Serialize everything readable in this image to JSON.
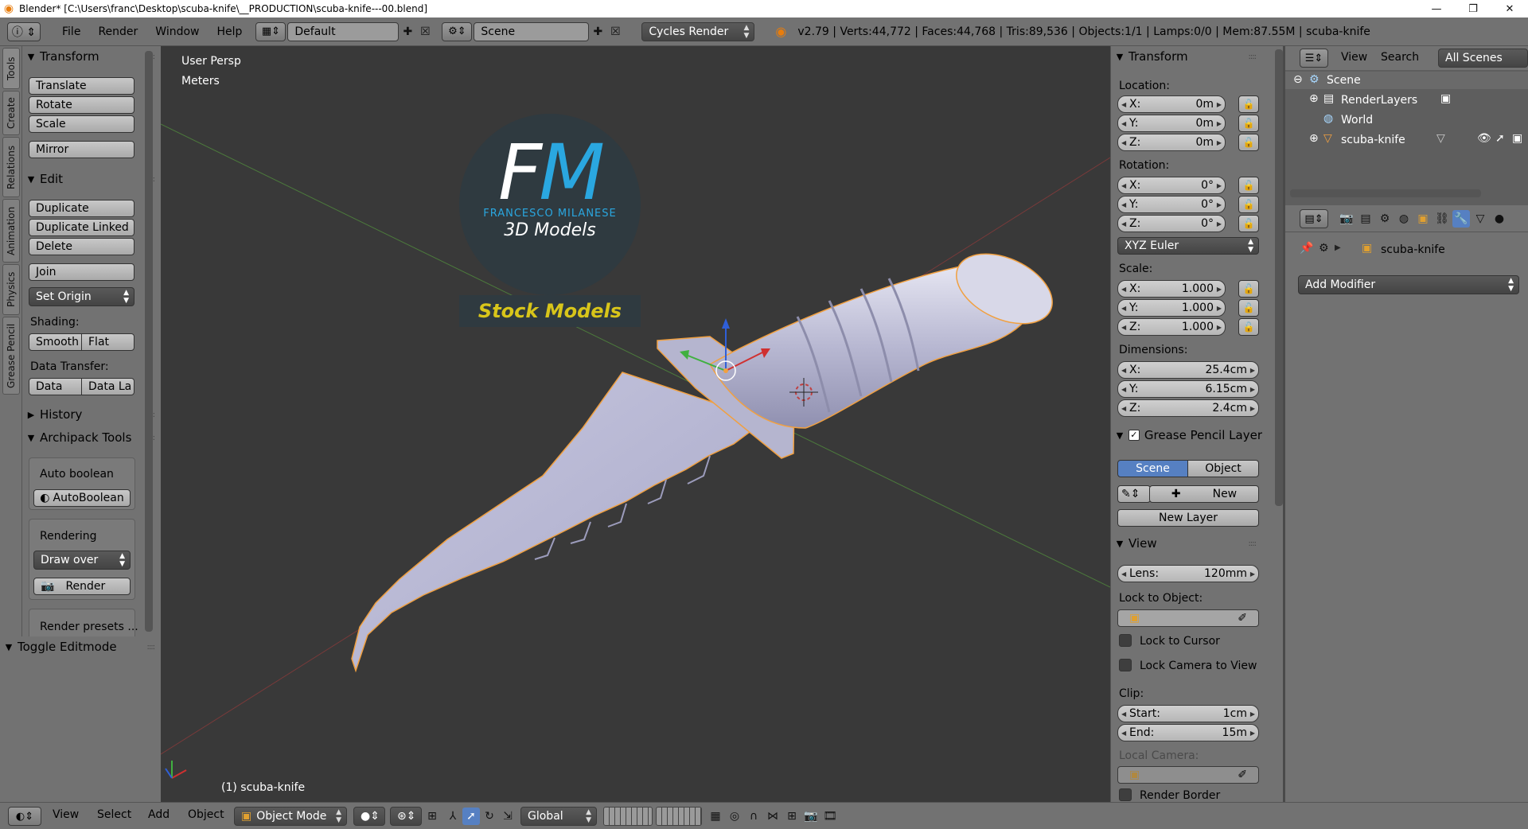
{
  "window": {
    "title": "Blender* [C:\\Users\\franc\\Desktop\\scuba-knife\\__PRODUCTION\\scuba-knife---00.blend]",
    "minimize": "—",
    "maximize": "❐",
    "close": "✕"
  },
  "info_header": {
    "menus": [
      "File",
      "Render",
      "Window",
      "Help"
    ],
    "screen_layout": "Default",
    "scene": "Scene",
    "render_engine": "Cycles Render",
    "stats": "v2.79 | Verts:44,772 | Faces:44,768 | Tris:89,536 | Objects:1/1 | Lamps:0/0 | Mem:87.55M | scuba-knife"
  },
  "left_tabs": [
    "Tools",
    "Create",
    "Relations",
    "Animation",
    "Physics",
    "Grease Pencil"
  ],
  "tool_shelf": {
    "transform": {
      "title": "Transform",
      "buttons": [
        "Translate",
        "Rotate",
        "Scale",
        "Mirror"
      ]
    },
    "edit": {
      "title": "Edit",
      "buttons": [
        "Duplicate",
        "Duplicate Linked",
        "Delete",
        "Join"
      ],
      "set_origin": "Set Origin",
      "shading_label": "Shading:",
      "smooth": "Smooth",
      "flat": "Flat",
      "data_transfer_label": "Data Transfer:",
      "data": "Data",
      "data_la": "Data La"
    },
    "history": {
      "title": "History"
    },
    "archipack": {
      "title": "Archipack Tools",
      "auto_boolean_label": "Auto boolean",
      "auto_boolean_btn": "AutoBoolean",
      "rendering_label": "Rendering",
      "draw_over": "Draw over",
      "render_btn": "Render",
      "render_presets": "Render presets ..."
    },
    "toggle_editmode": "Toggle Editmode"
  },
  "viewport": {
    "view_name": "User Persp",
    "units": "Meters",
    "object_label": "(1) scuba-knife",
    "logo_fm": "FM",
    "logo_name": "FRANCESCO MILANESE",
    "logo_3d": "3D Models",
    "logo_stock": "Stock Models"
  },
  "n_panel": {
    "transform_title": "Transform",
    "location_label": "Location:",
    "location": {
      "x": "0m",
      "y": "0m",
      "z": "0m"
    },
    "rotation_label": "Rotation:",
    "rotation": {
      "x": "0°",
      "y": "0°",
      "z": "0°"
    },
    "rotation_mode": "XYZ Euler",
    "scale_label": "Scale:",
    "scale": {
      "x": "1.000",
      "y": "1.000",
      "z": "1.000"
    },
    "dimensions_label": "Dimensions:",
    "dimensions": {
      "x": "25.4cm",
      "y": "6.15cm",
      "z": "2.4cm"
    },
    "axis_x": "X:",
    "axis_y": "Y:",
    "axis_z": "Z:",
    "grease_title": "Grease Pencil Layer",
    "scene_tab": "Scene",
    "object_tab": "Object",
    "new_btn": "New",
    "new_layer_btn": "New Layer",
    "view_title": "View",
    "lens_label": "Lens:",
    "lens_value": "120mm",
    "lock_to_object_label": "Lock to Object:",
    "lock_to_cursor": "Lock to Cursor",
    "lock_camera": "Lock Camera to View",
    "clip_label": "Clip:",
    "clip_start_label": "Start:",
    "clip_start": "1cm",
    "clip_end_label": "End:",
    "clip_end": "15m",
    "local_camera_label": "Local Camera:",
    "render_border": "Render Border"
  },
  "outliner": {
    "view": "View",
    "search": "Search",
    "filter": "All Scenes",
    "items": [
      "Scene",
      "RenderLayers",
      "World",
      "scuba-knife"
    ]
  },
  "properties": {
    "object_name": "scuba-knife",
    "add_modifier": "Add Modifier"
  },
  "bottom_header": {
    "menus": [
      "View",
      "Select",
      "Add",
      "Object"
    ],
    "mode": "Object Mode",
    "orientation": "Global"
  },
  "colors": {
    "panel_bg": "#727272",
    "viewport_bg": "#393939",
    "selected_blue": "#5680c2",
    "accent_orange": "#f1a040",
    "logo_blue": "#2aa7e0",
    "stock_yellow": "#d8c51a"
  }
}
